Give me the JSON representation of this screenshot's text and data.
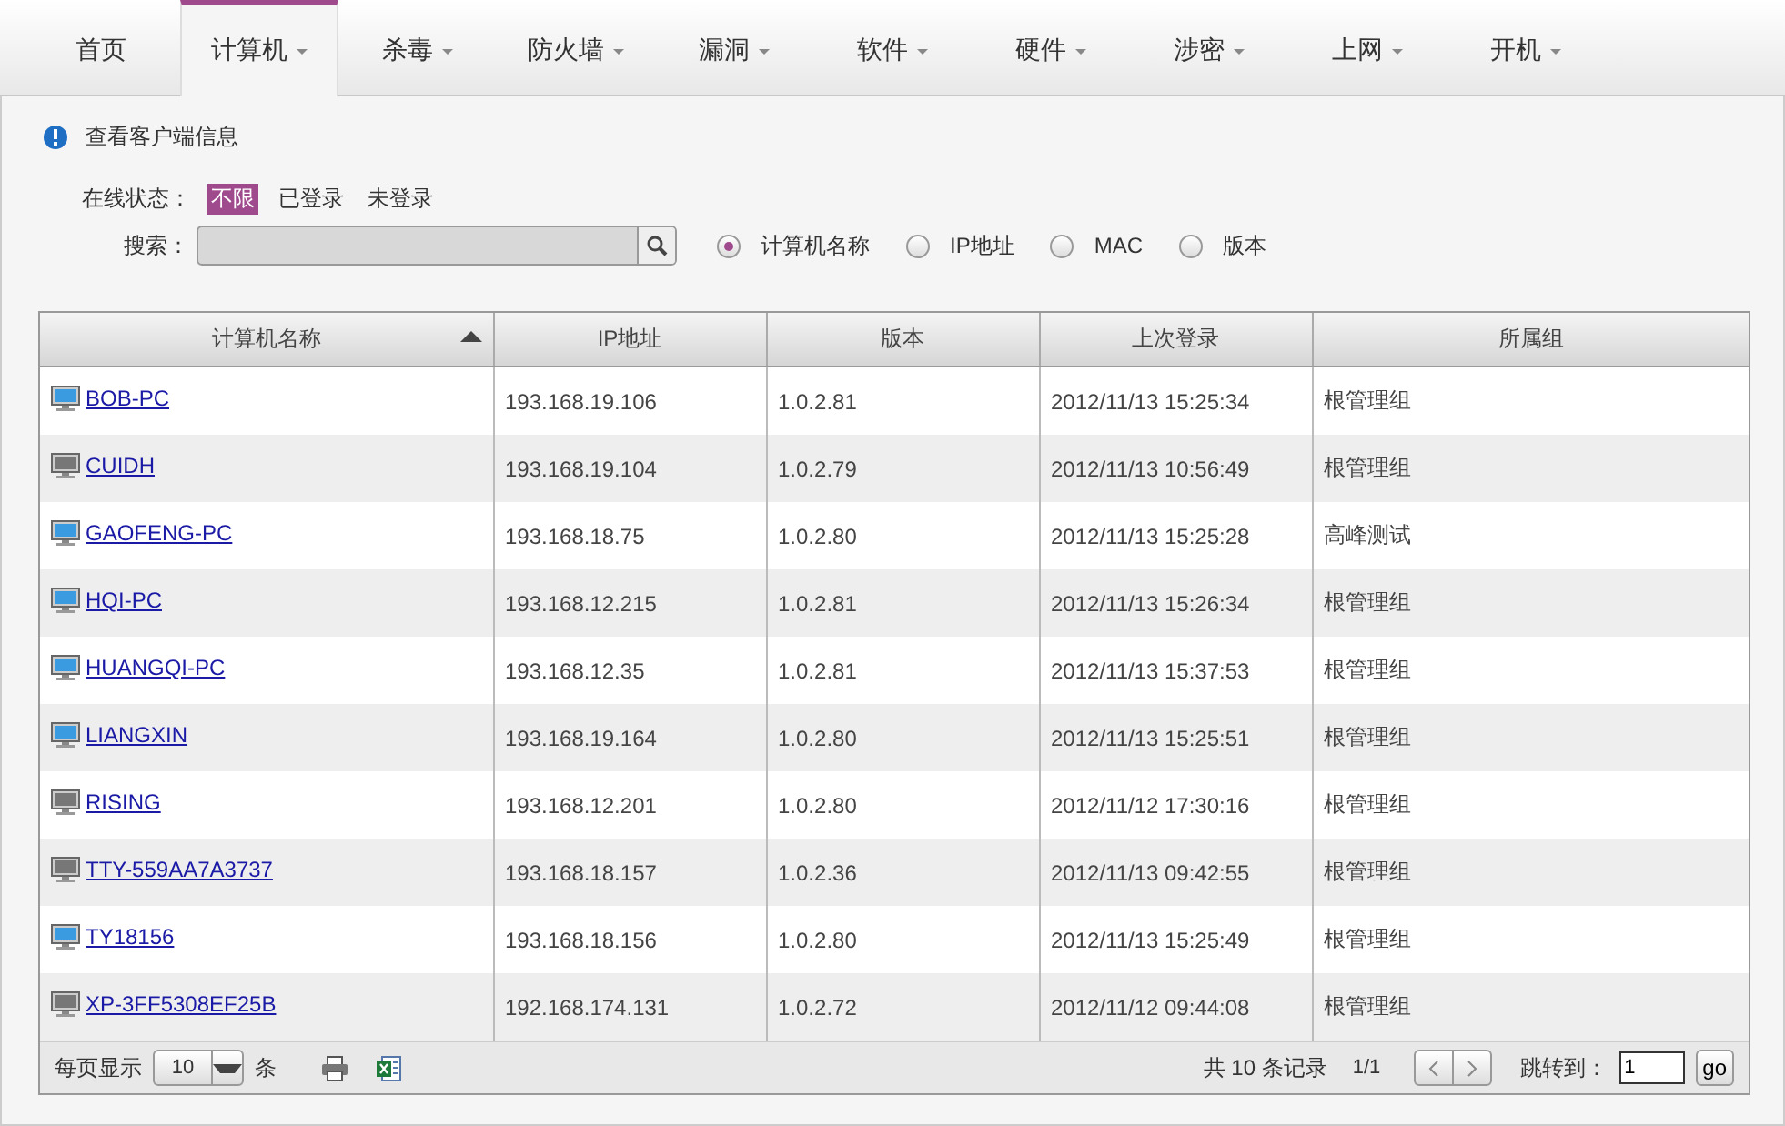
{
  "nav": {
    "tabs": [
      {
        "label": "首页",
        "has_menu": false,
        "selected": false
      },
      {
        "label": "计算机",
        "has_menu": true,
        "selected": true
      },
      {
        "label": "杀毒",
        "has_menu": true,
        "selected": false
      },
      {
        "label": "防火墙",
        "has_menu": true,
        "selected": false
      },
      {
        "label": "漏洞",
        "has_menu": true,
        "selected": false
      },
      {
        "label": "软件",
        "has_menu": true,
        "selected": false
      },
      {
        "label": "硬件",
        "has_menu": true,
        "selected": false
      },
      {
        "label": "涉密",
        "has_menu": true,
        "selected": false
      },
      {
        "label": "上网",
        "has_menu": true,
        "selected": false
      },
      {
        "label": "开机",
        "has_menu": true,
        "selected": false
      }
    ]
  },
  "info": {
    "text": "查看客户端信息"
  },
  "status_filter": {
    "label": "在线状态：",
    "options": [
      {
        "label": "不限",
        "selected": true
      },
      {
        "label": "已登录",
        "selected": false
      },
      {
        "label": "未登录",
        "selected": false
      }
    ]
  },
  "search": {
    "label": "搜索：",
    "modes": [
      {
        "label": "计算机名称",
        "selected": true
      },
      {
        "label": "IP地址",
        "selected": false
      },
      {
        "label": "MAC",
        "selected": false
      },
      {
        "label": "版本",
        "selected": false
      }
    ]
  },
  "table": {
    "columns": [
      {
        "label": "计算机名称",
        "sorted": true
      },
      {
        "label": "IP地址",
        "sorted": false
      },
      {
        "label": "版本",
        "sorted": false
      },
      {
        "label": "上次登录",
        "sorted": false
      },
      {
        "label": "所属组",
        "sorted": false
      }
    ],
    "rows": [
      {
        "online": true,
        "name": "BOB-PC",
        "ip": "193.168.19.106",
        "version": "1.0.2.81",
        "last_login": "2012/11/13 15:25:34",
        "group": "根管理组"
      },
      {
        "online": false,
        "name": "CUIDH",
        "ip": "193.168.19.104",
        "version": "1.0.2.79",
        "last_login": "2012/11/13 10:56:49",
        "group": "根管理组"
      },
      {
        "online": true,
        "name": "GAOFENG-PC",
        "ip": "193.168.18.75",
        "version": "1.0.2.80",
        "last_login": "2012/11/13 15:25:28",
        "group": "高峰测试"
      },
      {
        "online": true,
        "name": "HQI-PC",
        "ip": "193.168.12.215",
        "version": "1.0.2.81",
        "last_login": "2012/11/13 15:26:34",
        "group": "根管理组"
      },
      {
        "online": true,
        "name": "HUANGQI-PC",
        "ip": "193.168.12.35",
        "version": "1.0.2.81",
        "last_login": "2012/11/13 15:37:53",
        "group": "根管理组"
      },
      {
        "online": true,
        "name": "LIANGXIN",
        "ip": "193.168.19.164",
        "version": "1.0.2.80",
        "last_login": "2012/11/13 15:25:51",
        "group": "根管理组"
      },
      {
        "online": false,
        "name": "RISING",
        "ip": "193.168.12.201",
        "version": "1.0.2.80",
        "last_login": "2012/11/12 17:30:16",
        "group": "根管理组"
      },
      {
        "online": false,
        "name": "TTY-559AA7A3737",
        "ip": "193.168.18.157",
        "version": "1.0.2.36",
        "last_login": "2012/11/13 09:42:55",
        "group": "根管理组"
      },
      {
        "online": true,
        "name": "TY18156",
        "ip": "193.168.18.156",
        "version": "1.0.2.80",
        "last_login": "2012/11/13 15:25:49",
        "group": "根管理组"
      },
      {
        "online": false,
        "name": "XP-3FF5308EF25B",
        "ip": "192.168.174.131",
        "version": "1.0.2.72",
        "last_login": "2012/11/12 09:44:08",
        "group": "根管理组"
      }
    ]
  },
  "footer": {
    "per_page_label": "每页显示",
    "per_page": "10",
    "per_page_unit": "条",
    "total": "共 10 条记录",
    "pages": "1/1",
    "jump_label": "跳转到：",
    "jump_value": "1",
    "go": "go"
  }
}
